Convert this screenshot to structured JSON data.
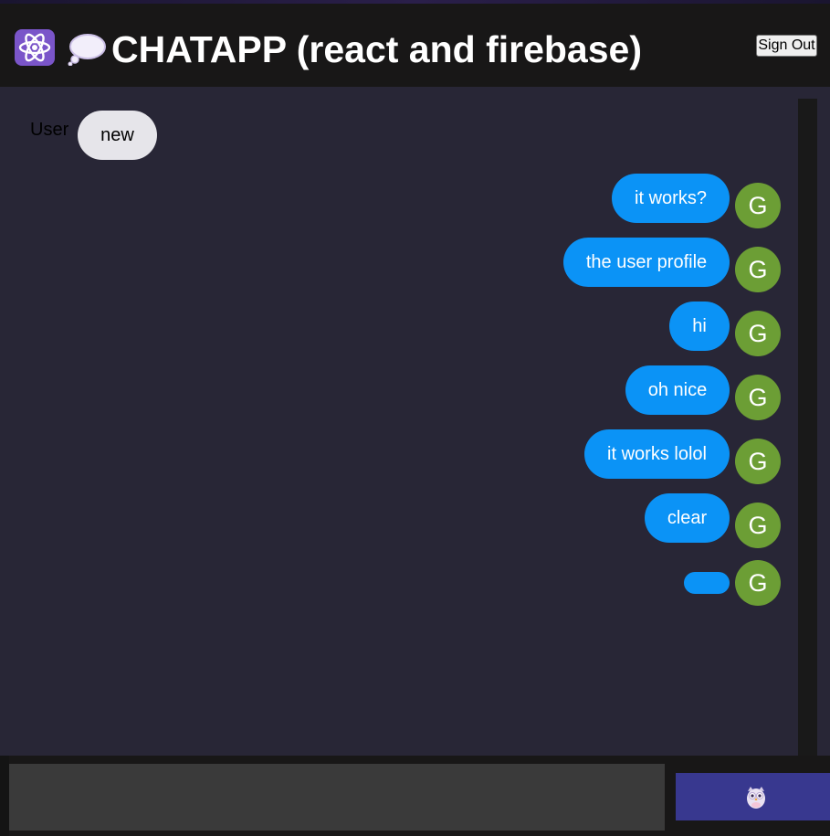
{
  "header": {
    "title": "CHATAPP (react and firebase)",
    "logo_icons": [
      "atom-icon",
      "speech-bubble-icon"
    ],
    "signout_label": "Sign Out"
  },
  "messages": [
    {
      "type": "received",
      "name": "User",
      "text": "new"
    },
    {
      "type": "sent",
      "text": "it works?",
      "avatar": "G"
    },
    {
      "type": "sent",
      "text": "the user profile",
      "avatar": "G"
    },
    {
      "type": "sent",
      "text": "hi",
      "avatar": "G"
    },
    {
      "type": "sent",
      "text": "oh nice",
      "avatar": "G"
    },
    {
      "type": "sent",
      "text": "it works lolol",
      "avatar": "G"
    },
    {
      "type": "sent",
      "text": "clear",
      "avatar": "G"
    },
    {
      "type": "sent",
      "text": "",
      "avatar": "G"
    }
  ],
  "form": {
    "input_value": "",
    "input_placeholder": "",
    "send_icon": "owl-icon"
  },
  "colors": {
    "header_bg": "#181717",
    "chat_bg": "#282636",
    "sent_bubble": "#0b93f6",
    "received_bubble": "#e6e5ea",
    "avatar_bg": "#6c9e35",
    "send_button": "#38388f",
    "input_bg": "#3a3a3a"
  }
}
